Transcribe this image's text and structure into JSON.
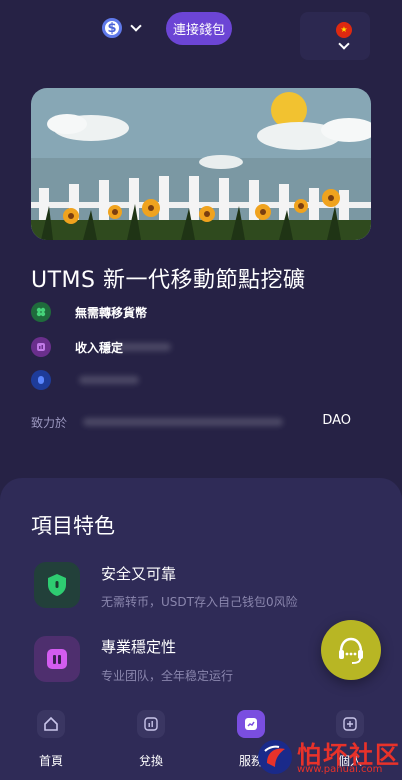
{
  "header": {
    "currency_symbol": "$",
    "connect_wallet": "連接錢包",
    "flag": "★"
  },
  "hero": {
    "title": "UTMS 新一代移動節點挖礦",
    "features": [
      {
        "label": "無需轉移貨幣",
        "color": "#2fa35a"
      },
      {
        "label": "收入穩定",
        "color": "#9b4cc9"
      },
      {
        "label": "",
        "color": "#2f5fe0"
      }
    ],
    "commit_label": "致力於",
    "commit_value": "DAO"
  },
  "project": {
    "title": "項目特色",
    "items": [
      {
        "title": "安全又可靠",
        "desc": "无需转币，USDT存入自己钱包0风险",
        "icon": "shield-icon",
        "color": "#2ecc71"
      },
      {
        "title": "專業穩定性",
        "desc": "专业团队，全年稳定运行",
        "icon": "bars-icon",
        "color": "#d35cf0"
      }
    ]
  },
  "tabs": [
    {
      "label": "首頁",
      "icon": "home-icon"
    },
    {
      "label": "兌換",
      "icon": "chart-icon"
    },
    {
      "label": "服務",
      "icon": "service-icon"
    },
    {
      "label": "個人",
      "icon": "profile-icon"
    }
  ],
  "watermark": {
    "text": "怕坏社区",
    "url": "www.pahuai.com"
  },
  "colors": {
    "background": "#262245",
    "accent": "#6c45d5",
    "panel": "#2f2b57"
  }
}
